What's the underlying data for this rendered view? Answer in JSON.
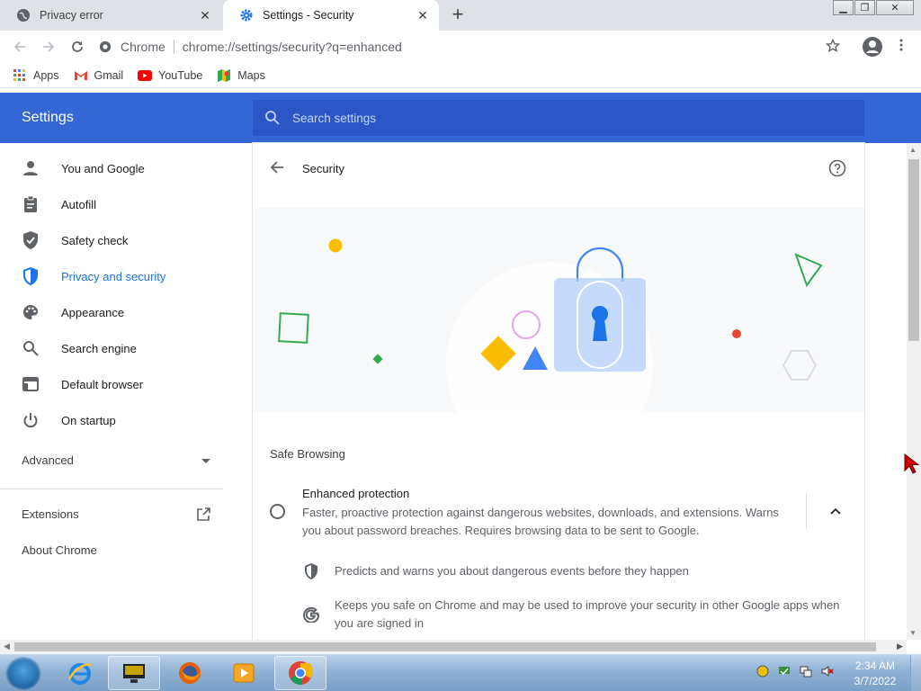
{
  "browser": {
    "tabs": [
      {
        "title": "Privacy error",
        "icon": "globe-icon",
        "active": false
      },
      {
        "title": "Settings - Security",
        "icon": "gear-icon",
        "active": true
      }
    ],
    "omnibox": {
      "site_label": "Chrome",
      "url": "chrome://settings/security?q=enhanced"
    },
    "bookmarks": [
      {
        "label": "Apps",
        "icon": "apps-grid-icon"
      },
      {
        "label": "Gmail",
        "icon": "gmail-icon"
      },
      {
        "label": "YouTube",
        "icon": "youtube-icon"
      },
      {
        "label": "Maps",
        "icon": "maps-icon"
      }
    ]
  },
  "settings": {
    "title": "Settings",
    "search_placeholder": "Search settings",
    "sidebar": {
      "items": [
        {
          "label": "You and Google",
          "icon": "person-icon",
          "active": false
        },
        {
          "label": "Autofill",
          "icon": "clipboard-icon",
          "active": false
        },
        {
          "label": "Safety check",
          "icon": "shield-check-icon",
          "active": false
        },
        {
          "label": "Privacy and security",
          "icon": "shield-icon",
          "active": true
        },
        {
          "label": "Appearance",
          "icon": "palette-icon",
          "active": false
        },
        {
          "label": "Search engine",
          "icon": "search-icon",
          "active": false
        },
        {
          "label": "Default browser",
          "icon": "browser-window-icon",
          "active": false
        },
        {
          "label": "On startup",
          "icon": "power-icon",
          "active": false
        }
      ],
      "advanced_label": "Advanced",
      "extensions_label": "Extensions",
      "about_label": "About Chrome"
    },
    "page": {
      "title": "Security",
      "section_title": "Safe Browsing",
      "option": {
        "title": "Enhanced protection",
        "description": "Faster, proactive protection against dangerous websites, downloads, and extensions. Warns you about password breaches. Requires browsing data to be sent to Google.",
        "selected": false,
        "expanded": true
      },
      "features": [
        {
          "icon": "shield-icon",
          "text": "Predicts and warns you about dangerous events before they happen"
        },
        {
          "icon": "google-g-icon",
          "text": "Keeps you safe on Chrome and may be used to improve your security in other Google apps when you are signed in"
        }
      ]
    }
  },
  "taskbar": {
    "apps": [
      "internet-explorer-icon",
      "app-icon",
      "firefox-icon",
      "media-player-icon",
      "chrome-icon"
    ],
    "clock_time": "2:34 AM",
    "clock_date": "3/7/2022"
  },
  "colors": {
    "header_blue": "#3367d6",
    "search_blue": "#2a56c6",
    "active_blue": "#1a73e8"
  }
}
